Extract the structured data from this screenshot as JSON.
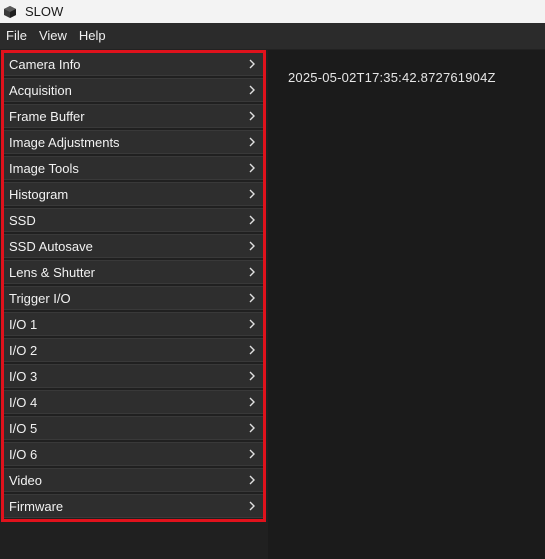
{
  "window": {
    "title": "SLOW",
    "icon": "cube-icon"
  },
  "menubar": {
    "items": [
      "File",
      "View",
      "Help"
    ]
  },
  "sidebar": {
    "items": [
      {
        "label": "Camera Info"
      },
      {
        "label": "Acquisition"
      },
      {
        "label": "Frame Buffer"
      },
      {
        "label": "Image Adjustments"
      },
      {
        "label": "Image Tools"
      },
      {
        "label": "Histogram"
      },
      {
        "label": "SSD"
      },
      {
        "label": "SSD Autosave"
      },
      {
        "label": "Lens & Shutter"
      },
      {
        "label": "Trigger I/O"
      },
      {
        "label": "I/O 1"
      },
      {
        "label": "I/O 2"
      },
      {
        "label": "I/O 3"
      },
      {
        "label": "I/O 4"
      },
      {
        "label": "I/O 5"
      },
      {
        "label": "I/O 6"
      },
      {
        "label": "Video"
      },
      {
        "label": "Firmware"
      }
    ],
    "item_icon": "chevron-right-icon"
  },
  "main": {
    "timestamp": "2025-05-02T17:35:42.872761904Z"
  },
  "colors": {
    "highlight": "#e0121c",
    "background": "#1b1b1b",
    "panel_item": "#2e2e2e",
    "titlebar": "#f3f3f3"
  }
}
